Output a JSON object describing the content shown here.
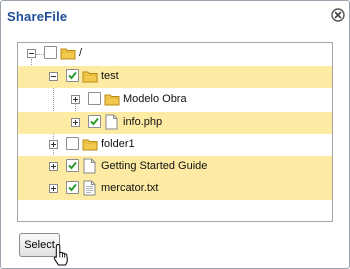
{
  "dialog": {
    "title": "ShareFile",
    "close_icon": "close-circle-icon"
  },
  "tree": {
    "root": {
      "label": "/",
      "checked": false,
      "expanded": true,
      "icon": "folder-icon"
    },
    "items": [
      {
        "label": "test",
        "checked": true,
        "expanded": true,
        "highlighted": true,
        "icon": "folder-icon"
      },
      {
        "label": "Modelo Obra",
        "checked": false,
        "expanded": false,
        "highlighted": false,
        "icon": "folder-icon"
      },
      {
        "label": "info.php",
        "checked": true,
        "expanded": false,
        "highlighted": true,
        "icon": "blank-file-icon"
      },
      {
        "label": "folder1",
        "checked": false,
        "expanded": false,
        "highlighted": false,
        "icon": "folder-icon"
      },
      {
        "label": "Getting Started Guide",
        "checked": true,
        "expanded": false,
        "highlighted": true,
        "icon": "blank-file-icon"
      },
      {
        "label": "mercator.txt",
        "checked": true,
        "expanded": false,
        "highlighted": true,
        "icon": "text-file-icon"
      }
    ]
  },
  "select_button": {
    "label": "Select"
  },
  "colors": {
    "title": "#1f4f95",
    "highlight": "#fdeaa3",
    "check": "#2c9a2c",
    "folder": "#f2c94c"
  }
}
